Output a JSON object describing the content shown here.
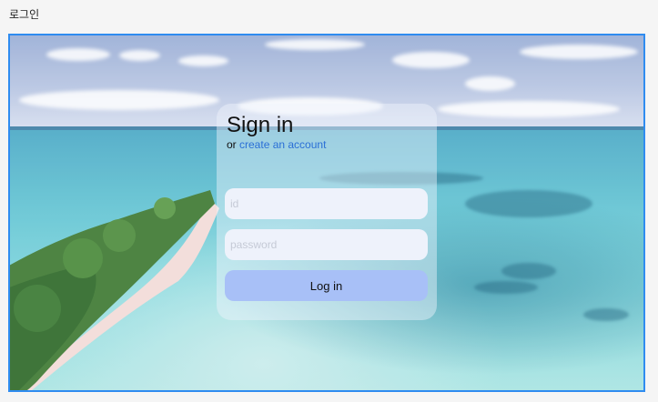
{
  "page": {
    "header": "로그인"
  },
  "login": {
    "title": "Sign in",
    "subtitle_prefix": "or",
    "create_account_link": "create an account",
    "id_placeholder": "id",
    "password_placeholder": "password",
    "submit_label": "Log in"
  },
  "colors": {
    "frame_border": "#2f8cf0",
    "link": "#2a6fd6",
    "button": "#a8c0f7",
    "field_background": "#eef2fb"
  },
  "background": {
    "scene": "tropical island beach aerial view"
  }
}
